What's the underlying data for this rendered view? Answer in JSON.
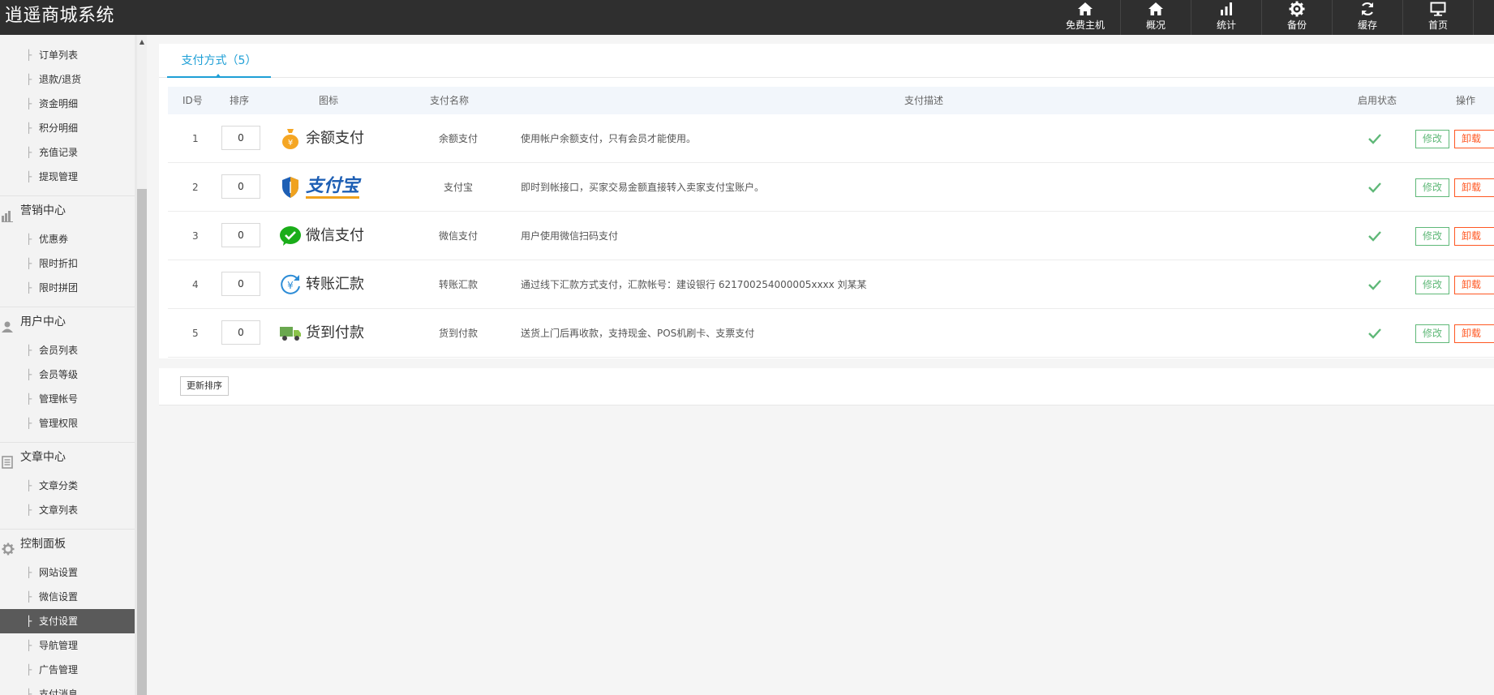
{
  "app": {
    "title": "逍遥商城系统"
  },
  "topnav": [
    {
      "label": "免费主机",
      "icon": "home-icon"
    },
    {
      "label": "概况",
      "icon": "home-icon"
    },
    {
      "label": "统计",
      "icon": "bar-chart-icon"
    },
    {
      "label": "备份",
      "icon": "gear-icon"
    },
    {
      "label": "缓存",
      "icon": "refresh-icon"
    },
    {
      "label": "首页",
      "icon": "monitor-icon"
    }
  ],
  "sidebar": {
    "order_items": [
      "订单列表",
      "退款/退货",
      "资金明细",
      "积分明细",
      "充值记录",
      "提现管理"
    ],
    "groups": [
      {
        "label": "营销中心",
        "icon": "chart-icon",
        "items": [
          "优惠券",
          "限时折扣",
          "限时拼团"
        ]
      },
      {
        "label": "用户中心",
        "icon": "user-icon",
        "items": [
          "会员列表",
          "会员等级",
          "管理帐号",
          "管理权限"
        ]
      },
      {
        "label": "文章中心",
        "icon": "document-icon",
        "items": [
          "文章分类",
          "文章列表"
        ]
      },
      {
        "label": "控制面板",
        "icon": "gear-icon",
        "items": [
          "网站设置",
          "微信设置",
          "支付设置",
          "导航管理",
          "广告管理",
          "支付消息"
        ]
      }
    ],
    "active_item": "支付设置"
  },
  "tabs": [
    {
      "label": "支付方式（5）"
    }
  ],
  "table": {
    "headers": {
      "id": "ID号",
      "sort": "排序",
      "icon": "图标",
      "name": "支付名称",
      "desc": "支付描述",
      "status": "启用状态",
      "ops": "操作"
    },
    "rows": [
      {
        "id": "1",
        "sort": "0",
        "logo_text": "余额支付",
        "logo_icon": "money-bag-icon",
        "name": "余额支付",
        "desc": "使用帐户余额支付，只有会员才能使用。",
        "enabled": true
      },
      {
        "id": "2",
        "sort": "0",
        "logo_text": "支付宝",
        "logo_icon": "alipay-shield-icon",
        "name": "支付宝",
        "desc": "即时到帐接口，买家交易金额直接转入卖家支付宝账户。",
        "enabled": true
      },
      {
        "id": "3",
        "sort": "0",
        "logo_text": "微信支付",
        "logo_icon": "wechat-pay-icon",
        "name": "微信支付",
        "desc": "用户使用微信扫码支付",
        "enabled": true
      },
      {
        "id": "4",
        "sort": "0",
        "logo_text": "转账汇款",
        "logo_icon": "transfer-icon",
        "name": "转账汇款",
        "desc": "通过线下汇款方式支付，汇款帐号：建设银行 621700254000005xxxx 刘某某",
        "enabled": true
      },
      {
        "id": "5",
        "sort": "0",
        "logo_text": "货到付款",
        "logo_icon": "delivery-truck-icon",
        "name": "货到付款",
        "desc": "送货上门后再收款，支持现金、POS机刷卡、支票支付",
        "enabled": true
      }
    ],
    "edit_label": "修改",
    "uninstall_label": "卸载"
  },
  "footer": {
    "update_sort_label": "更新排序"
  },
  "colors": {
    "topbar": "#2f2f2f",
    "accent": "#1e9fd6",
    "edit": "#5fb878",
    "uninstall": "#ff5722",
    "active_sidebar": "#5a5a5a"
  }
}
